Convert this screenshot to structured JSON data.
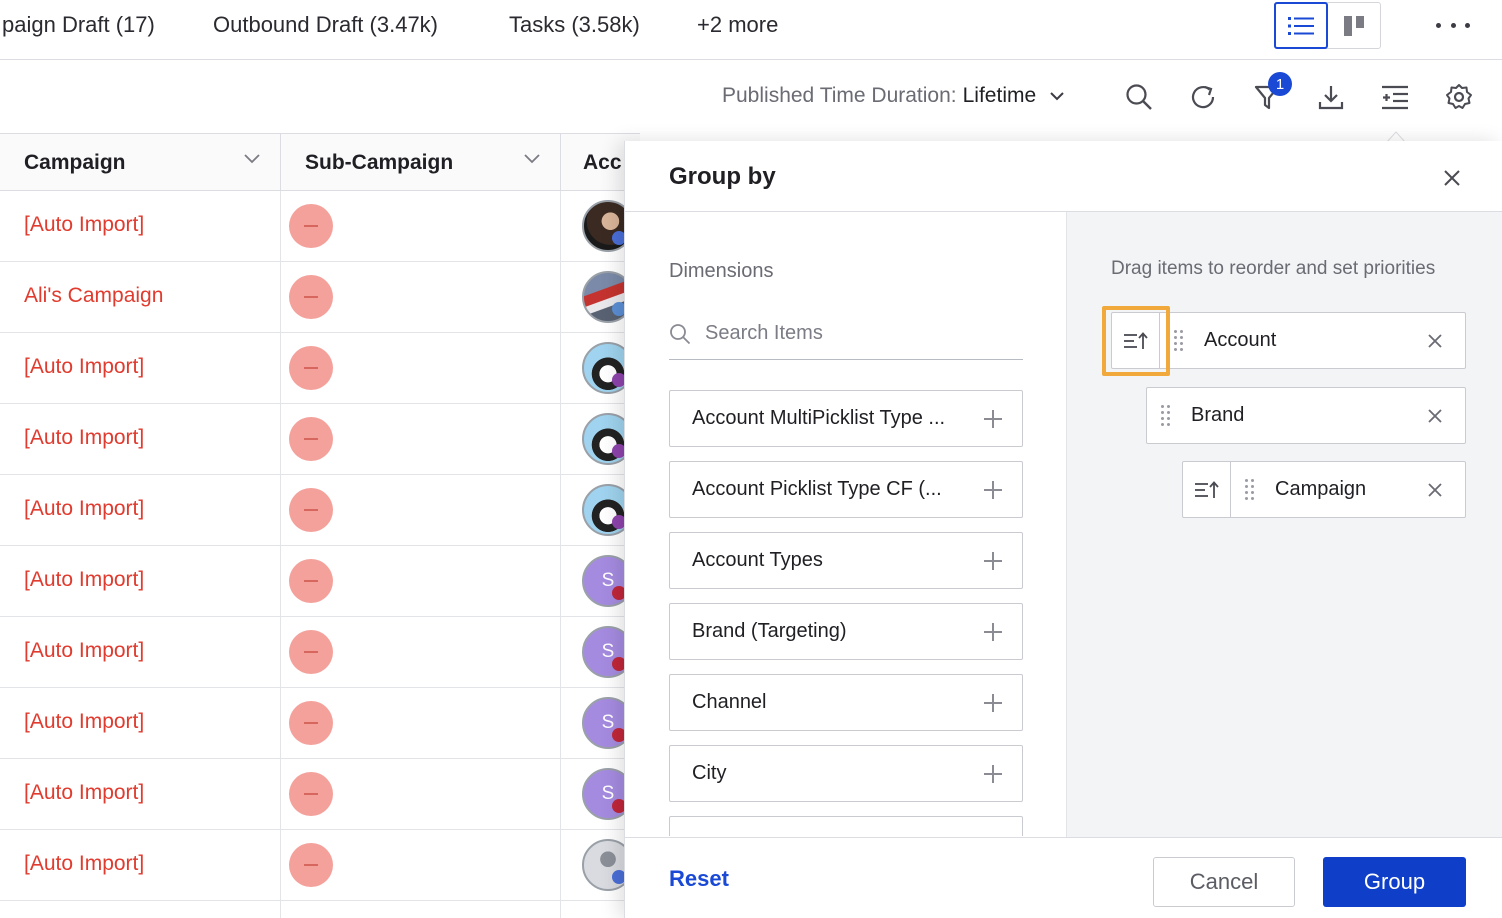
{
  "tabs": [
    {
      "label": "paign Draft (17)"
    },
    {
      "label": "Outbound Draft (3.47k)"
    },
    {
      "label": "Tasks (3.58k)"
    },
    {
      "label": "+2 more"
    }
  ],
  "view_toggle": {
    "active": "list-view",
    "icons": [
      "list-icon",
      "kanban-icon"
    ]
  },
  "toolbar": {
    "duration_label": "Published Time Duration:",
    "duration_value": "Lifetime",
    "filter_count": "1",
    "icons": [
      "search-icon",
      "refresh-icon",
      "filter-icon",
      "download-icon",
      "group-by-icon",
      "settings-icon"
    ]
  },
  "table": {
    "columns": [
      "Campaign",
      "Sub-Campaign",
      "Acc"
    ],
    "rows": [
      {
        "campaign": "[Auto Import]",
        "avatar": "photo1"
      },
      {
        "campaign": "Ali's Campaign",
        "avatar": "photo2"
      },
      {
        "campaign": "[Auto Import]",
        "avatar": "tux"
      },
      {
        "campaign": "[Auto Import]",
        "avatar": "tux"
      },
      {
        "campaign": "[Auto Import]",
        "avatar": "tux"
      },
      {
        "campaign": "[Auto Import]",
        "avatar": "S"
      },
      {
        "campaign": "[Auto Import]",
        "avatar": "S"
      },
      {
        "campaign": "[Auto Import]",
        "avatar": "S"
      },
      {
        "campaign": "[Auto Import]",
        "avatar": "S"
      },
      {
        "campaign": "[Auto Import]",
        "avatar": "gray"
      }
    ]
  },
  "group_by": {
    "title": "Group by",
    "dimensions_label": "Dimensions",
    "search_placeholder": "Search Items",
    "dimensions": [
      "Account MultiPicklist Type ...",
      "Account Picklist Type CF (...",
      "Account Types",
      "Brand (Targeting)",
      "Channel",
      "City"
    ],
    "drag_hint": "Drag items to reorder and set priorities",
    "selected": [
      {
        "label": "Account",
        "sortable": true
      },
      {
        "label": "Brand",
        "sortable": false
      },
      {
        "label": "Campaign",
        "sortable": true
      }
    ],
    "reset_label": "Reset",
    "cancel_label": "Cancel",
    "group_label": "Group"
  },
  "colors": {
    "accent": "#1a49d6",
    "campaign_text": "#e03b2e",
    "pill": "#f4a19c",
    "highlight": "#f0a93a"
  }
}
